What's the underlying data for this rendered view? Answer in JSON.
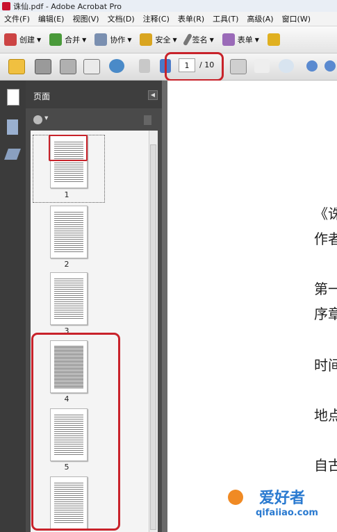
{
  "window": {
    "title": "诛仙.pdf - Adobe Acrobat Pro"
  },
  "menubar": {
    "items": [
      "文件(F)",
      "编辑(E)",
      "视图(V)",
      "文档(D)",
      "注释(C)",
      "表单(R)",
      "工具(T)",
      "高级(A)",
      "窗口(W)"
    ]
  },
  "toolbar": {
    "create": "创建",
    "combine": "合并",
    "collaborate": "协作",
    "secure": "安全",
    "sign": "签名",
    "forms": "表单"
  },
  "navigation": {
    "current_page": "1",
    "total_pages": "/ 10"
  },
  "pages_panel": {
    "title": "页面",
    "thumbnails": [
      {
        "label": "1"
      },
      {
        "label": "2"
      },
      {
        "label": "3"
      },
      {
        "label": "4"
      },
      {
        "label": "5"
      }
    ]
  },
  "document": {
    "lines": [
      "《诛",
      "作者",
      "第一",
      "序章",
      "时间",
      "地点",
      "自古"
    ]
  },
  "watermark": {
    "text": "爱好者",
    "url": "qifaiiao.com"
  },
  "colors": {
    "highlight": "#c8222a",
    "panel_bg": "#4a4a4a"
  }
}
